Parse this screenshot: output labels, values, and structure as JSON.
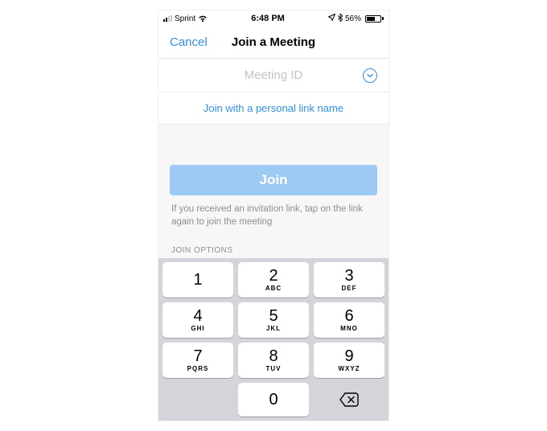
{
  "status": {
    "carrier": "Sprint",
    "time": "6:48 PM",
    "battery_pct": "56%"
  },
  "nav": {
    "cancel_label": "Cancel",
    "title": "Join a Meeting"
  },
  "meeting_id": {
    "placeholder": "Meeting ID"
  },
  "personal_link_label": "Join with a personal link name",
  "join_button_label": "Join",
  "hint_text": "If you received an invitation link, tap on the link again to join the meeting",
  "options_label": "JOIN OPTIONS",
  "keypad": {
    "k1": {
      "d": "1",
      "l": ""
    },
    "k2": {
      "d": "2",
      "l": "ABC"
    },
    "k3": {
      "d": "3",
      "l": "DEF"
    },
    "k4": {
      "d": "4",
      "l": "GHI"
    },
    "k5": {
      "d": "5",
      "l": "JKL"
    },
    "k6": {
      "d": "6",
      "l": "MNO"
    },
    "k7": {
      "d": "7",
      "l": "PQRS"
    },
    "k8": {
      "d": "8",
      "l": "TUV"
    },
    "k9": {
      "d": "9",
      "l": "WXYZ"
    },
    "k0": {
      "d": "0",
      "l": ""
    }
  }
}
